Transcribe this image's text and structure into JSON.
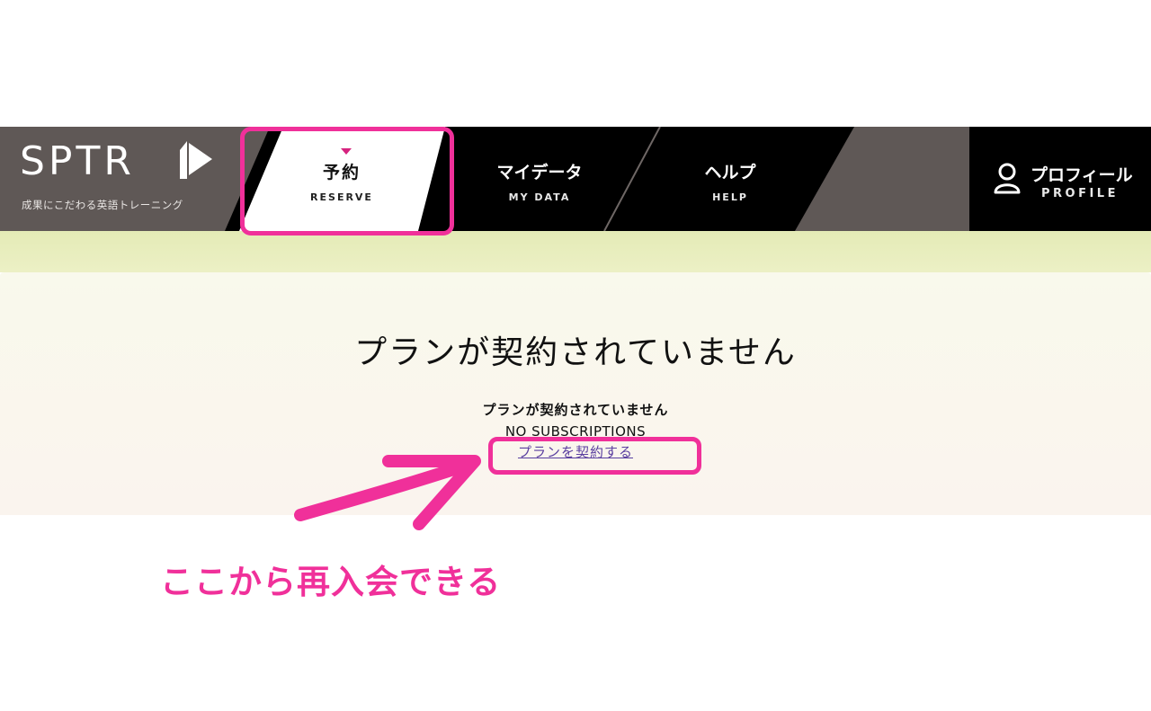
{
  "header": {
    "logo": "SPTR",
    "tagline": "成果にこだわる英語トレーニング",
    "nav": [
      {
        "jp": "予約",
        "en": "RESERVE"
      },
      {
        "jp": "マイデータ",
        "en": "MY DATA"
      },
      {
        "jp": "ヘルプ",
        "en": "HELP"
      }
    ],
    "profile": {
      "jp": "プロフィール",
      "en": "PROFILE"
    }
  },
  "main": {
    "title": "プランが契約されていません",
    "message_jp": "プランが契約されていません",
    "message_en": "NO SUBSCRIPTIONS",
    "link": "プランを契約する"
  },
  "annotation": {
    "text": "ここから再入会できる"
  },
  "colors": {
    "highlight": "#f0309a",
    "accent": "#d6237f",
    "header_brown": "#5f5856",
    "link": "#5a3fa0"
  }
}
